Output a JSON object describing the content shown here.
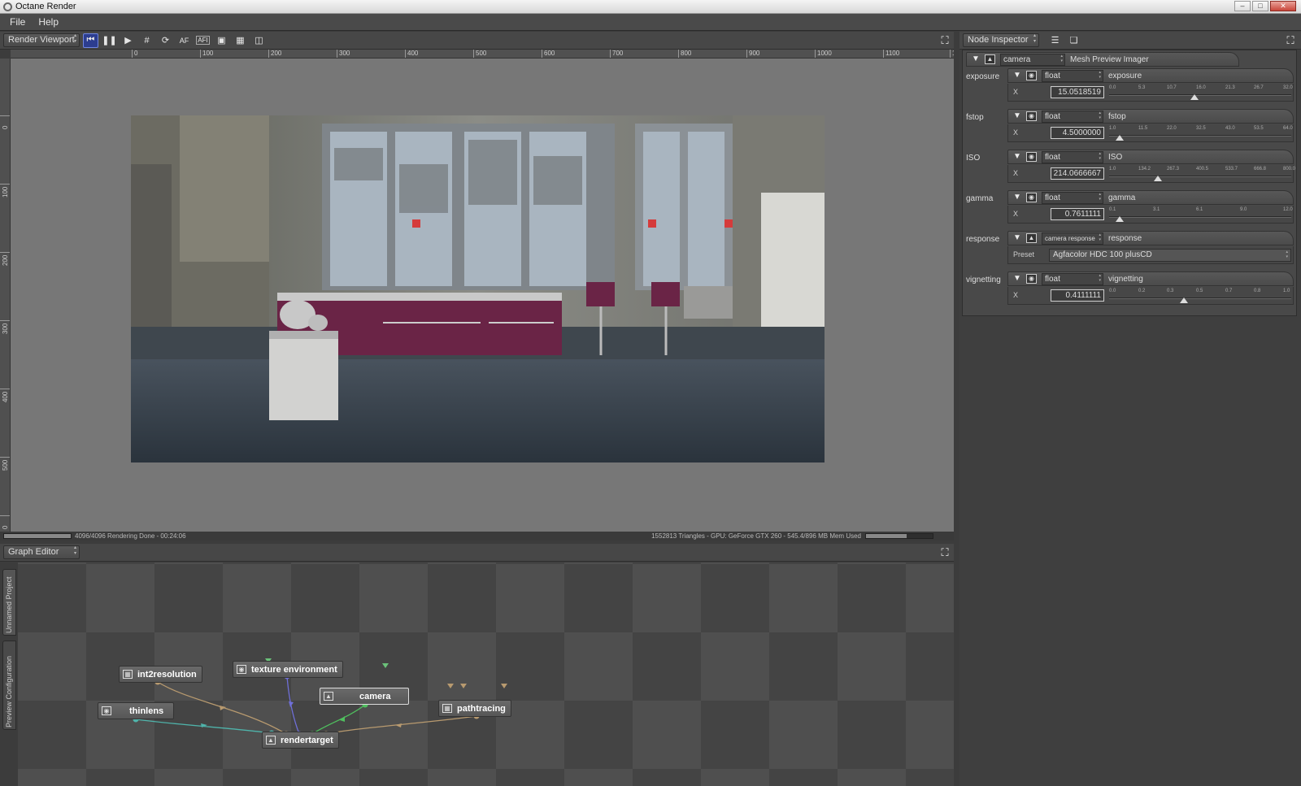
{
  "window": {
    "title": "Octane Render"
  },
  "menu": {
    "items": [
      "File",
      "Help"
    ]
  },
  "viewport": {
    "panel_combo": "Render Viewport",
    "toolbar": {
      "af_label": "AF",
      "afi_label": "AFI"
    },
    "ruler_h": [
      "0",
      "100",
      "200",
      "300",
      "400",
      "500",
      "600",
      "700",
      "800",
      "900",
      "1000",
      "1100",
      "12"
    ],
    "ruler_v": [
      "0",
      "100",
      "200",
      "300",
      "400",
      "500",
      "0"
    ],
    "status_left": "4096/4096 Rendering Done - 00:24:06",
    "status_right": "1552813 Triangles - GPU: GeForce GTX 260 - 545.4/896 MB Mem Used",
    "render_progress": 1.0,
    "mem_usage": 0.61
  },
  "graph": {
    "panel_combo": "Graph Editor",
    "side_tabs": [
      "Unnamed Project",
      "Preview Configuration"
    ],
    "nodes": {
      "int2resolution": "int2resolution",
      "texture_environment": "texture environment",
      "camera": "camera",
      "pathtracing": "pathtracing",
      "thinlens": "thinlens",
      "rendertarget": "rendertarget"
    }
  },
  "inspector": {
    "panel_combo": "Node Inspector",
    "header": {
      "node_combo": "camera",
      "node_type": "Mesh Preview Imager"
    },
    "params": [
      {
        "label": "exposure",
        "type": "float",
        "name": "exposure",
        "axis": "X",
        "value": "15.0518519",
        "ticks": [
          "0.0",
          "5.3",
          "10.7",
          "16.0",
          "21.3",
          "26.7",
          "32.0"
        ],
        "pos": 0.47
      },
      {
        "label": "fstop",
        "type": "float",
        "name": "fstop",
        "axis": "X",
        "value": "4.5000000",
        "ticks": [
          "1.0",
          "11.5",
          "22.0",
          "32.5",
          "43.0",
          "53.5",
          "64.0"
        ],
        "pos": 0.06
      },
      {
        "label": "ISO",
        "type": "float",
        "name": "ISO",
        "axis": "X",
        "value": "214.0666667",
        "ticks": [
          "1.0",
          "134.2",
          "267.3",
          "400.5",
          "533.7",
          "666.8",
          "800.0"
        ],
        "pos": 0.27
      },
      {
        "label": "gamma",
        "type": "float",
        "name": "gamma",
        "axis": "X",
        "value": "0.7611111",
        "ticks": [
          "0.1",
          "3.1",
          "6.1",
          "9.0",
          "12.0"
        ],
        "pos": 0.06
      },
      {
        "label": "response",
        "type": "camera response",
        "name": "response",
        "preset_label": "Preset",
        "preset": "Agfacolor HDC 100 plusCD"
      },
      {
        "label": "vignetting",
        "type": "float",
        "name": "vignetting",
        "axis": "X",
        "value": "0.4111111",
        "ticks": [
          "0.0",
          "0.2",
          "0.3",
          "0.5",
          "0.7",
          "0.8",
          "1.0"
        ],
        "pos": 0.41
      }
    ]
  }
}
